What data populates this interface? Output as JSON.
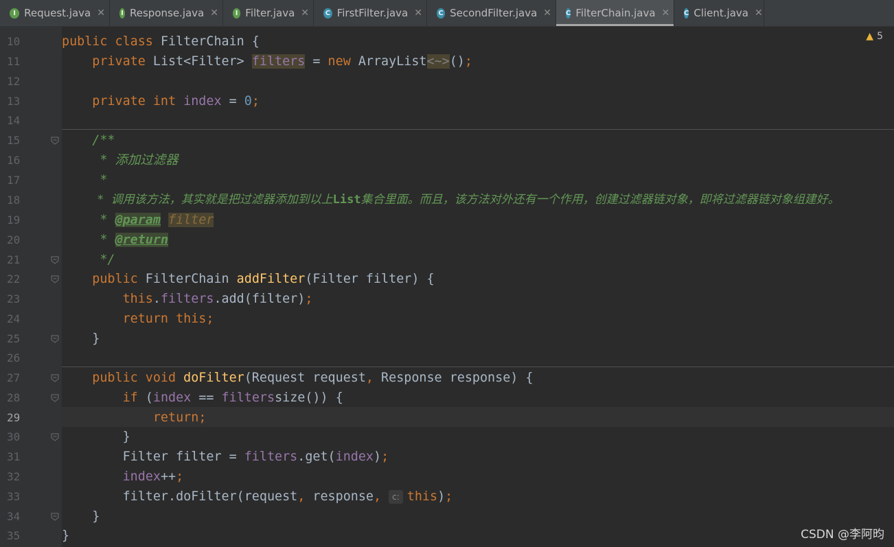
{
  "tabs": [
    {
      "label": "Request.java",
      "icon": "interface-icon",
      "glyph": "I"
    },
    {
      "label": "Response.java",
      "icon": "interface-icon",
      "glyph": "I"
    },
    {
      "label": "Filter.java",
      "icon": "interface-icon",
      "glyph": "I"
    },
    {
      "label": "FirstFilter.java",
      "icon": "class-icon",
      "glyph": "C"
    },
    {
      "label": "SecondFilter.java",
      "icon": "class-icon",
      "glyph": "C"
    },
    {
      "label": "FilterChain.java",
      "icon": "class-icon",
      "glyph": "C",
      "active": true
    },
    {
      "label": "Client.java",
      "icon": "class-main-icon",
      "glyph": "C"
    }
  ],
  "close_glyph": "✕",
  "warnings": {
    "icon": "warning-icon",
    "count": "5"
  },
  "line_numbers": [
    "10",
    "11",
    "12",
    "13",
    "14",
    "15",
    "16",
    "17",
    "18",
    "19",
    "20",
    "21",
    "22",
    "23",
    "24",
    "25",
    "26",
    "27",
    "28",
    "29",
    "30",
    "31",
    "32",
    "33",
    "34",
    "35"
  ],
  "current_line": "29",
  "code": {
    "l10": {
      "a": "public class ",
      "b": "FilterChain {"
    },
    "l11": {
      "a": "    private ",
      "b": "List<Filter> ",
      "c": "filters",
      "d": " = ",
      "e": "new ",
      "f": "ArrayList",
      "g": "<~>",
      "h": "()",
      ";": ";"
    },
    "l13": {
      "a": "    private int ",
      "b": "index",
      "c": " = ",
      "d": "0",
      ";": ";"
    },
    "l15": {
      "a": "    /**"
    },
    "l16": {
      "a": "     * 添加过滤器"
    },
    "l17": {
      "a": "     *"
    },
    "l18": {
      "a": "     * 调用该方法，其实就是把过滤器添加到以上",
      "b": "List",
      "c": "集合里面。而且，该方法对外还有一个作用，创建过滤器链对象，即将过滤器链对象组建好。"
    },
    "l19": {
      "a": "     * ",
      "b": "@param",
      "c": " ",
      "d": "filter"
    },
    "l20": {
      "a": "     * ",
      "b": "@return"
    },
    "l21": {
      "a": "     */"
    },
    "l22": {
      "a": "    public ",
      "b": "FilterChain ",
      "c": "addFilter",
      "d": "(Filter filter) {"
    },
    "l23": {
      "a": "        this",
      "b": ".",
      "c": "filters",
      "d": ".add(filter)",
      ";": ";"
    },
    "l24": {
      "a": "        return this",
      ";": ";"
    },
    "l25": {
      "a": "    }"
    },
    "l27": {
      "a": "    public void ",
      "b": "doFilter",
      "c": "(Request request",
      ",": ", ",
      "d": "Response response) {"
    },
    "l28": {
      "a": "        if ",
      "b": "(",
      "c": "index",
      "d": " == ",
      "e": "filters",
      ".": ".",
      "f": "size()) {"
    },
    "l29": {
      "a": "            return",
      ";": ";"
    },
    "l30": {
      "a": "        }"
    },
    "l31": {
      "a": "        Filter filter = ",
      "b": "filters",
      "c": ".get(",
      "d": "index",
      ")": ")",
      ";": ";"
    },
    "l32": {
      "a": "        ",
      "b": "index",
      "c": "++",
      ";": ";"
    },
    "l33": {
      "a": "        filter.doFilter(request",
      ",": ", ",
      "b": "response",
      ",2": ", ",
      "hint": "c:",
      "c": "this",
      ")": ")",
      ";": ";"
    },
    "l34": {
      "a": "    }"
    },
    "l35": {
      "a": "}"
    }
  },
  "watermark": "CSDN @李阿昀"
}
